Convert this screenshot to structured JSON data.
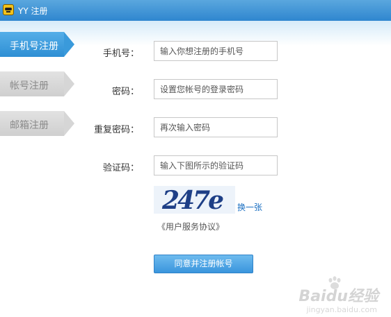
{
  "window": {
    "title": "YY 注册",
    "logo_icon": "yy-logo-icon"
  },
  "tabs": [
    {
      "label": "手机号注册",
      "active": true
    },
    {
      "label": "帐号注册",
      "active": false
    },
    {
      "label": "邮箱注册",
      "active": false
    }
  ],
  "form": {
    "phone": {
      "label": "手机号：",
      "placeholder": "输入你想注册的手机号"
    },
    "password": {
      "label": "密码：",
      "placeholder": "设置您帐号的登录密码"
    },
    "confirm": {
      "label": "重复密码：",
      "placeholder": "再次输入密码"
    },
    "captcha": {
      "label": "验证码：",
      "placeholder": "输入下图所示的验证码",
      "image_text": "247e",
      "refresh": "换一张"
    },
    "agreement": "《用户服务协议》",
    "submit": "同意并注册帐号"
  },
  "watermark": {
    "brand": "Baidu经验",
    "url": "jingyan.baidu.com"
  },
  "colors": {
    "accent": "#2e8fd4",
    "link": "#1a6fc2",
    "captcha_text": "#1e3f86"
  }
}
